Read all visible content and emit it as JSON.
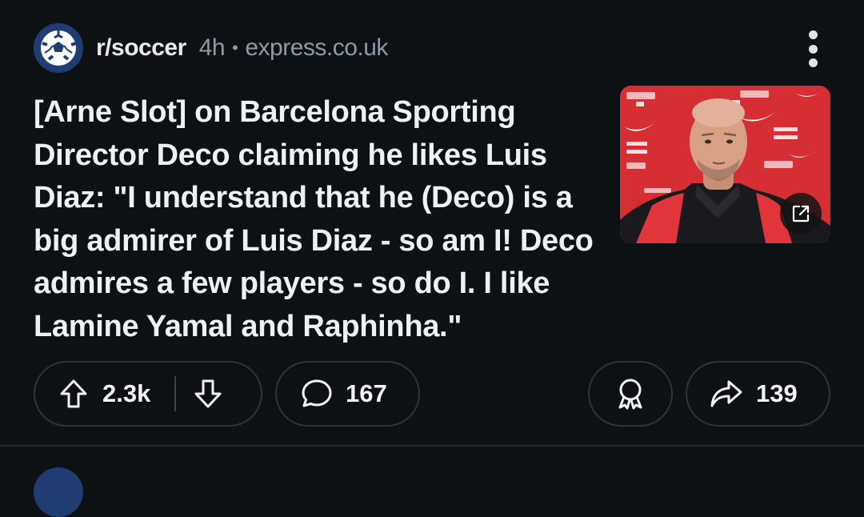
{
  "post": {
    "subreddit": "r/soccer",
    "age": "4h",
    "separator": "•",
    "domain": "express.co.uk",
    "title": "[Arne Slot] on Barcelona Sporting Director Deco claiming he likes Luis Diaz: \"I understand that he (Deco) is a big admirer of Luis Diaz - so am I! Deco admires a few players - so do I. I like Lamine Yamal and Raphinha.\"",
    "thumbnail": {
      "description": "man at press conference in front of red sponsor backdrop",
      "backdrop_color": "#d62f33"
    }
  },
  "actions": {
    "upvotes": "2.3k",
    "comments": "167",
    "shares": "139"
  },
  "icons": {
    "subreddit_avatar": "soccer-ball-icon",
    "menu": "more-vertical-icon",
    "upvote": "arrow-up-icon",
    "downvote": "arrow-down-icon",
    "comment": "comment-bubble-icon",
    "award": "award-ribbon-icon",
    "share": "share-arrow-icon",
    "external_link": "external-link-icon"
  },
  "colors": {
    "background": "#0e1113",
    "pill_border": "#2e3438",
    "meta_text": "#8c9aa6",
    "subreddit_avatar_bg": "#1f3c73"
  }
}
